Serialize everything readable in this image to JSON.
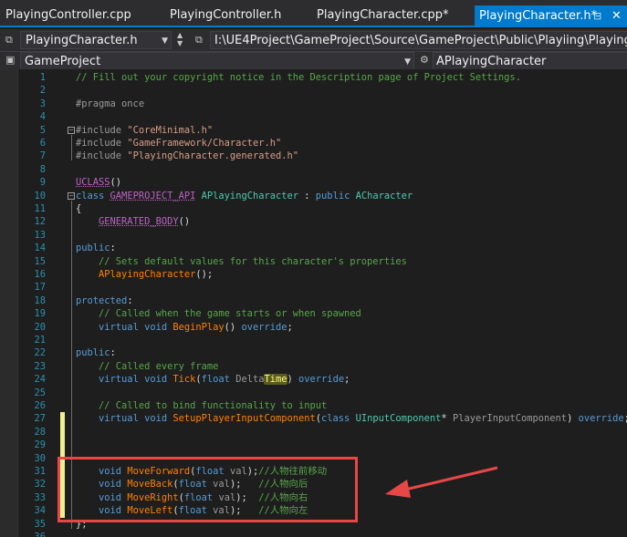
{
  "tabs": [
    {
      "label": "PlayingController.cpp",
      "active": false
    },
    {
      "label": "PlayingController.h",
      "active": false
    },
    {
      "label": "PlayingCharacter.cpp*",
      "active": false
    },
    {
      "label": "PlayingCharacter.h*",
      "active": true
    }
  ],
  "nav": {
    "file_combo": "PlayingCharacter.h",
    "path_combo": "I:\\UE4Project\\GameProject\\Source\\GameProject\\Public\\Playiing\\PlayingCharac",
    "project_combo": "GameProject",
    "symbol_combo": "APlayingCharacter"
  },
  "editor": {
    "lines": [
      {
        "n": "1",
        "tokens": [
          [
            "cmt",
            "// Fill out your copyright notice in the Description page of Project Settings."
          ]
        ]
      },
      {
        "n": "2",
        "tokens": []
      },
      {
        "n": "3",
        "tokens": [
          [
            "pre",
            "#pragma once"
          ]
        ]
      },
      {
        "n": "4",
        "tokens": []
      },
      {
        "n": "5",
        "tokens": [
          [
            "pre",
            "#include "
          ],
          [
            "str",
            "\"CoreMinimal.h\""
          ]
        ],
        "fold": "-"
      },
      {
        "n": "6",
        "tokens": [
          [
            "pre",
            "#include "
          ],
          [
            "str",
            "\"GameFramework/Character.h\""
          ]
        ]
      },
      {
        "n": "7",
        "tokens": [
          [
            "pre",
            "#include "
          ],
          [
            "str",
            "\"PlayingCharacter.generated.h\""
          ]
        ]
      },
      {
        "n": "8",
        "tokens": []
      },
      {
        "n": "9",
        "tokens": [
          [
            "macro",
            "UCLASS"
          ],
          [
            "txt",
            "()"
          ]
        ]
      },
      {
        "n": "10",
        "tokens": [
          [
            "kw",
            "class "
          ],
          [
            "macro",
            "GAMEPROJECT_API"
          ],
          [
            "txt",
            " "
          ],
          [
            "type",
            "APlayingCharacter"
          ],
          [
            "txt",
            " : "
          ],
          [
            "kw",
            "public "
          ],
          [
            "type",
            "ACharacter"
          ]
        ],
        "fold": "-"
      },
      {
        "n": "11",
        "tokens": [
          [
            "txt",
            "{"
          ]
        ]
      },
      {
        "n": "12",
        "tokens": [
          [
            "txt",
            "    "
          ],
          [
            "macro",
            "GENERATED_BODY"
          ],
          [
            "txt",
            "()"
          ]
        ]
      },
      {
        "n": "13",
        "tokens": []
      },
      {
        "n": "14",
        "tokens": [
          [
            "kw",
            "public"
          ],
          [
            "txt",
            ":"
          ]
        ]
      },
      {
        "n": "15",
        "tokens": [
          [
            "txt",
            "    "
          ],
          [
            "cmt",
            "// Sets default values for this character's properties"
          ]
        ]
      },
      {
        "n": "16",
        "tokens": [
          [
            "txt",
            "    "
          ],
          [
            "fn",
            "APlayingCharacter"
          ],
          [
            "txt",
            "();"
          ]
        ]
      },
      {
        "n": "17",
        "tokens": []
      },
      {
        "n": "18",
        "tokens": [
          [
            "kw",
            "protected"
          ],
          [
            "txt",
            ":"
          ]
        ]
      },
      {
        "n": "19",
        "tokens": [
          [
            "txt",
            "    "
          ],
          [
            "cmt",
            "// Called when the game starts or when spawned"
          ]
        ]
      },
      {
        "n": "20",
        "tokens": [
          [
            "txt",
            "    "
          ],
          [
            "kw",
            "virtual void "
          ],
          [
            "fn",
            "BeginPlay"
          ],
          [
            "txt",
            "() "
          ],
          [
            "kw",
            "override"
          ],
          [
            "txt",
            ";"
          ]
        ]
      },
      {
        "n": "21",
        "tokens": []
      },
      {
        "n": "22",
        "tokens": [
          [
            "kw",
            "public"
          ],
          [
            "txt",
            ":"
          ]
        ]
      },
      {
        "n": "23",
        "tokens": [
          [
            "txt",
            "    "
          ],
          [
            "cmt",
            "// Called every frame"
          ]
        ]
      },
      {
        "n": "24",
        "tokens": [
          [
            "txt",
            "    "
          ],
          [
            "kw",
            "virtual void "
          ],
          [
            "fn",
            "Tick"
          ],
          [
            "txt",
            "("
          ],
          [
            "kw",
            "float "
          ],
          [
            "param",
            "Delta"
          ],
          [
            "hl",
            "Time"
          ],
          [
            "txt",
            ") "
          ],
          [
            "kw",
            "override"
          ],
          [
            "txt",
            ";"
          ]
        ]
      },
      {
        "n": "25",
        "tokens": []
      },
      {
        "n": "26",
        "tokens": [
          [
            "txt",
            "    "
          ],
          [
            "cmt",
            "// Called to bind functionality to input"
          ]
        ]
      },
      {
        "n": "27",
        "tokens": [
          [
            "txt",
            "    "
          ],
          [
            "kw",
            "virtual void "
          ],
          [
            "fn",
            "SetupPlayerInputComponent"
          ],
          [
            "txt",
            "("
          ],
          [
            "kw",
            "class "
          ],
          [
            "type",
            "UInputComponent"
          ],
          [
            "txt",
            "* "
          ],
          [
            "param",
            "PlayerInputComponent"
          ],
          [
            "txt",
            ") "
          ],
          [
            "kw",
            "override"
          ],
          [
            "txt",
            ";"
          ]
        ],
        "changed": true
      },
      {
        "n": "28",
        "tokens": [],
        "changed": true
      },
      {
        "n": "29",
        "tokens": [],
        "changed": true
      },
      {
        "n": "30",
        "tokens": [],
        "changed": true
      },
      {
        "n": "31",
        "tokens": [
          [
            "txt",
            "    "
          ],
          [
            "kw",
            "void "
          ],
          [
            "fn",
            "MoveForward"
          ],
          [
            "txt",
            "("
          ],
          [
            "kw",
            "float "
          ],
          [
            "param",
            "val"
          ],
          [
            "txt",
            ");"
          ],
          [
            "cmt",
            "//人物往前移动"
          ]
        ],
        "changed": true
      },
      {
        "n": "32",
        "tokens": [
          [
            "txt",
            "    "
          ],
          [
            "kw",
            "void "
          ],
          [
            "fn",
            "MoveBack"
          ],
          [
            "txt",
            "("
          ],
          [
            "kw",
            "float "
          ],
          [
            "param",
            "val"
          ],
          [
            "txt",
            ");   "
          ],
          [
            "cmt",
            "//人物向后"
          ]
        ],
        "changed": true
      },
      {
        "n": "33",
        "tokens": [
          [
            "txt",
            "    "
          ],
          [
            "kw",
            "void "
          ],
          [
            "fn",
            "MoveRight"
          ],
          [
            "txt",
            "("
          ],
          [
            "kw",
            "float "
          ],
          [
            "param",
            "val"
          ],
          [
            "txt",
            ");  "
          ],
          [
            "cmt",
            "//人物向右"
          ]
        ],
        "changed": true
      },
      {
        "n": "34",
        "tokens": [
          [
            "txt",
            "    "
          ],
          [
            "kw",
            "void "
          ],
          [
            "fn",
            "MoveLeft"
          ],
          [
            "txt",
            "("
          ],
          [
            "kw",
            "float "
          ],
          [
            "param",
            "val"
          ],
          [
            "txt",
            ");   "
          ],
          [
            "cmt",
            "//人物向左"
          ]
        ],
        "changed": true
      },
      {
        "n": "35",
        "tokens": [
          [
            "txt",
            "};"
          ]
        ]
      },
      {
        "n": "36",
        "tokens": []
      }
    ]
  },
  "colors": {
    "accent": "#007acc",
    "annotation": "#e84747"
  }
}
